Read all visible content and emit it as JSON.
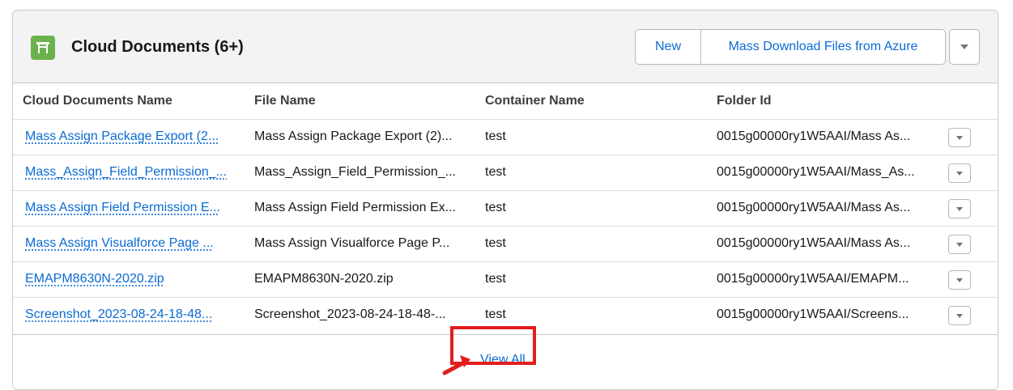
{
  "header": {
    "title": "Cloud Documents (6+)",
    "icon": "folder-icon",
    "new_label": "New",
    "mass_download_label": "Mass Download Files from Azure"
  },
  "table": {
    "columns": [
      "Cloud Documents Name",
      "File Name",
      "Container Name",
      "Folder Id"
    ],
    "rows": [
      {
        "name": "Mass Assign Package Export (2...",
        "file": "Mass Assign Package Export (2)...",
        "container": "test",
        "folder": "0015g00000ry1W5AAI/Mass As..."
      },
      {
        "name": "Mass_Assign_Field_Permission_...",
        "file": "Mass_Assign_Field_Permission_...",
        "container": "test",
        "folder": "0015g00000ry1W5AAI/Mass_As..."
      },
      {
        "name": "Mass Assign Field Permission E...",
        "file": "Mass Assign Field Permission Ex...",
        "container": "test",
        "folder": "0015g00000ry1W5AAI/Mass As..."
      },
      {
        "name": "Mass Assign Visualforce Page ...",
        "file": "Mass Assign Visualforce Page P...",
        "container": "test",
        "folder": "0015g00000ry1W5AAI/Mass As..."
      },
      {
        "name": "EMAPM8630N-2020.zip",
        "file": "EMAPM8630N-2020.zip",
        "container": "test",
        "folder": "0015g00000ry1W5AAI/EMAPM..."
      },
      {
        "name": "Screenshot_2023-08-24-18-48...",
        "file": "Screenshot_2023-08-24-18-48-...",
        "container": "test",
        "folder": "0015g00000ry1W5AAI/Screens..."
      }
    ]
  },
  "footer": {
    "view_all_label": "View All"
  },
  "colors": {
    "accent": "#0a6bd3",
    "icon_bg": "#6bb14f",
    "highlight": "#e31d1d"
  }
}
